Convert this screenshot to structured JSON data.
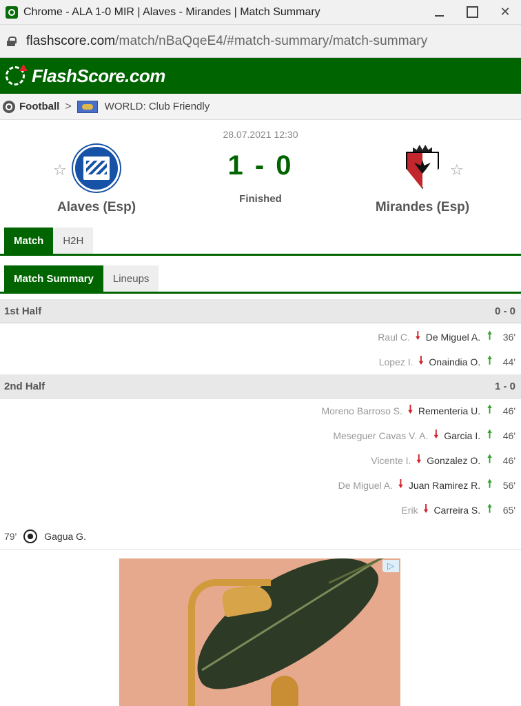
{
  "window": {
    "title": "Chrome - ALA 1-0 MIR | Alaves - Mirandes | Match Summary"
  },
  "address": {
    "domain": "flashscore.com",
    "path": "/match/nBaQqeE4/#match-summary/match-summary"
  },
  "header": {
    "logo_text": "FlashScore.com"
  },
  "breadcrumb": {
    "sport": "Football",
    "chevron": ">",
    "league": "WORLD: Club Friendly"
  },
  "match": {
    "date": "28.07.2021 12:30",
    "score": "1 - 0",
    "status": "Finished",
    "home": {
      "name": "Alaves (Esp)"
    },
    "away": {
      "name": "Mirandes (Esp)"
    },
    "star_glyph": "☆"
  },
  "tabs_main": [
    {
      "label": "Match",
      "active": true
    },
    {
      "label": "H2H",
      "active": false
    }
  ],
  "tabs_sub": [
    {
      "label": "Match Summary",
      "active": true
    },
    {
      "label": "Lineups",
      "active": false
    }
  ],
  "summary": {
    "first_half": {
      "label": "1st Half",
      "score": "0 - 0",
      "subs": [
        {
          "out": "Raul C.",
          "in": "De Miguel A.",
          "minute": "36'"
        },
        {
          "out": "Lopez I.",
          "in": "Onaindia O.",
          "minute": "44'"
        }
      ]
    },
    "second_half": {
      "label": "2nd Half",
      "score": "1 - 0",
      "subs": [
        {
          "out": "Moreno Barroso S.",
          "in": "Rementeria U.",
          "minute": "46'"
        },
        {
          "out": "Meseguer Cavas V. A.",
          "in": "Garcia I.",
          "minute": "46'"
        },
        {
          "out": "Vicente I.",
          "in": "Gonzalez O.",
          "minute": "46'"
        },
        {
          "out": "De Miguel A.",
          "in": "Juan Ramirez R.",
          "minute": "56'"
        },
        {
          "out": "Erik",
          "in": "Carreira S.",
          "minute": "65'"
        }
      ],
      "goal": {
        "minute": "79'",
        "player": "Gagua G."
      }
    }
  },
  "icons": {
    "arrow_down": "🠗",
    "arrow_up": "🠕",
    "ad_badge": "▷"
  },
  "colors": {
    "brand_green": "#006400",
    "sub_out_arrow": "#d0202a",
    "sub_in_arrow": "#36a12e"
  }
}
